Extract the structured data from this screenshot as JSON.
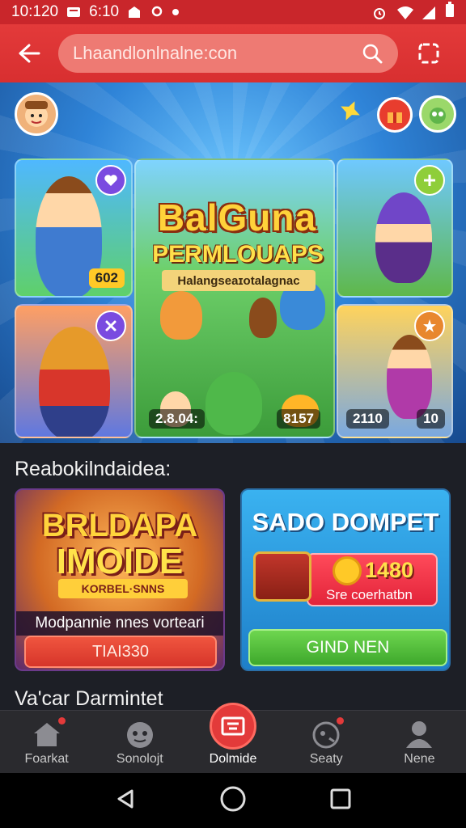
{
  "status_bar": {
    "time": "10:120",
    "alt_time": "6:10"
  },
  "top_bar": {
    "url": "Lhaandlonlnalne:con"
  },
  "banner": {
    "title": "BalGuna",
    "subtitle": "PERMLOUAPS",
    "tag": "Halangseaɪotalagnac",
    "tiles": [
      {
        "badge": "602"
      },
      {
        "badge": "2.8.04:"
      },
      {
        "badge": "8157"
      },
      {
        "badge": "2110"
      },
      {
        "badge": "10"
      }
    ]
  },
  "section": {
    "title": "Reabokilndaidea:",
    "title2": "Va'car Darmintet"
  },
  "card_left": {
    "title_line1": "BRLDAPA",
    "title_line2": "IMOIDE",
    "tag": "KORBEL·SNNS",
    "caption": "Modpannie nnes vorteari",
    "button": "TIAI330"
  },
  "card_right": {
    "title": "SADO DOMPET",
    "value": "1480",
    "caption": "Sre coerhatbn",
    "button": "GIND NEN"
  },
  "bottom_nav": {
    "items": [
      {
        "label": "Foarkat",
        "icon": "house-icon"
      },
      {
        "label": "Sonolojt",
        "icon": "face-icon"
      },
      {
        "label": "Dolmide",
        "icon": "shop-icon"
      },
      {
        "label": "Seaty",
        "icon": "bird-icon"
      },
      {
        "label": "Nene",
        "icon": "profile-icon"
      }
    ]
  },
  "colors": {
    "accent": "#e33a3a",
    "background": "#1d1f26",
    "green_button": "#4fbc3a"
  }
}
